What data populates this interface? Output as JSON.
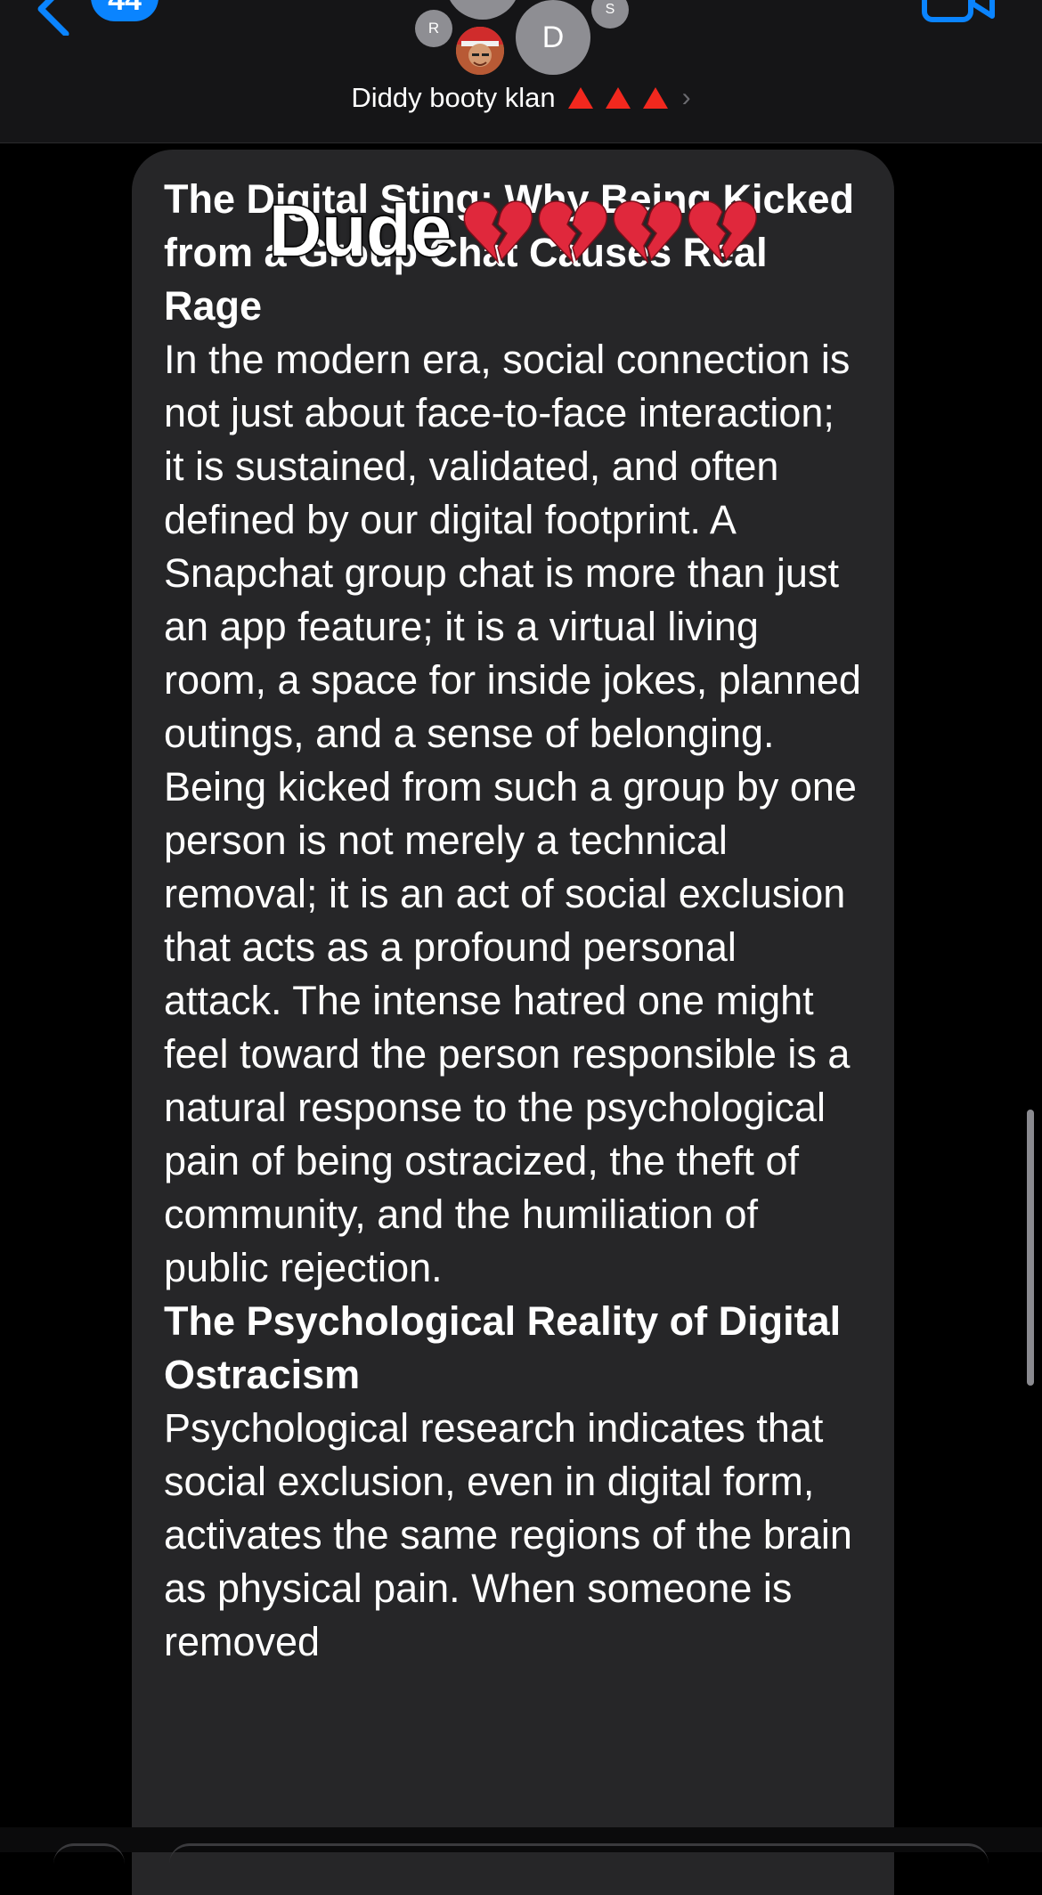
{
  "header": {
    "back_badge_count": "44",
    "avatars": {
      "r_initial": "R",
      "d_initial": "D",
      "s_initial": "S"
    },
    "group_name": "Diddy booty klan",
    "group_name_emoji": "🔺🔺🔺"
  },
  "message": {
    "reaction": {
      "text": "Dude",
      "emoji": "💔💔💔💔"
    },
    "blocks": [
      {
        "type": "heading",
        "text": "The Digital Sting: Why Being Kicked from a Group Chat Causes Real Rage"
      },
      {
        "type": "paragraph",
        "text": "In the modern era, social connection is not just about face-to-face interaction; it is sustained, validated, and often defined by our digital footprint. A Snapchat group chat is more than just an app feature; it is a virtual living room, a space for inside jokes, planned outings, and a sense of belonging. Being kicked from such a group by one person is not merely a technical removal; it is an act of social exclusion that acts as a profound personal attack. The intense hatred one might feel toward the person responsible is a natural response to the psychological pain of being ostracized, the theft of community, and the humiliation of public rejection."
      },
      {
        "type": "heading",
        "text": "The Psychological Reality of Digital Ostracism"
      },
      {
        "type": "paragraph",
        "text": "Psychological research indicates that social exclusion, even in digital form, activates the same regions of the brain as physical pain. When someone is removed"
      }
    ]
  },
  "colors": {
    "accent": "#0a84ff",
    "bubble": "#262628",
    "background": "#000000",
    "header": "#151517"
  }
}
